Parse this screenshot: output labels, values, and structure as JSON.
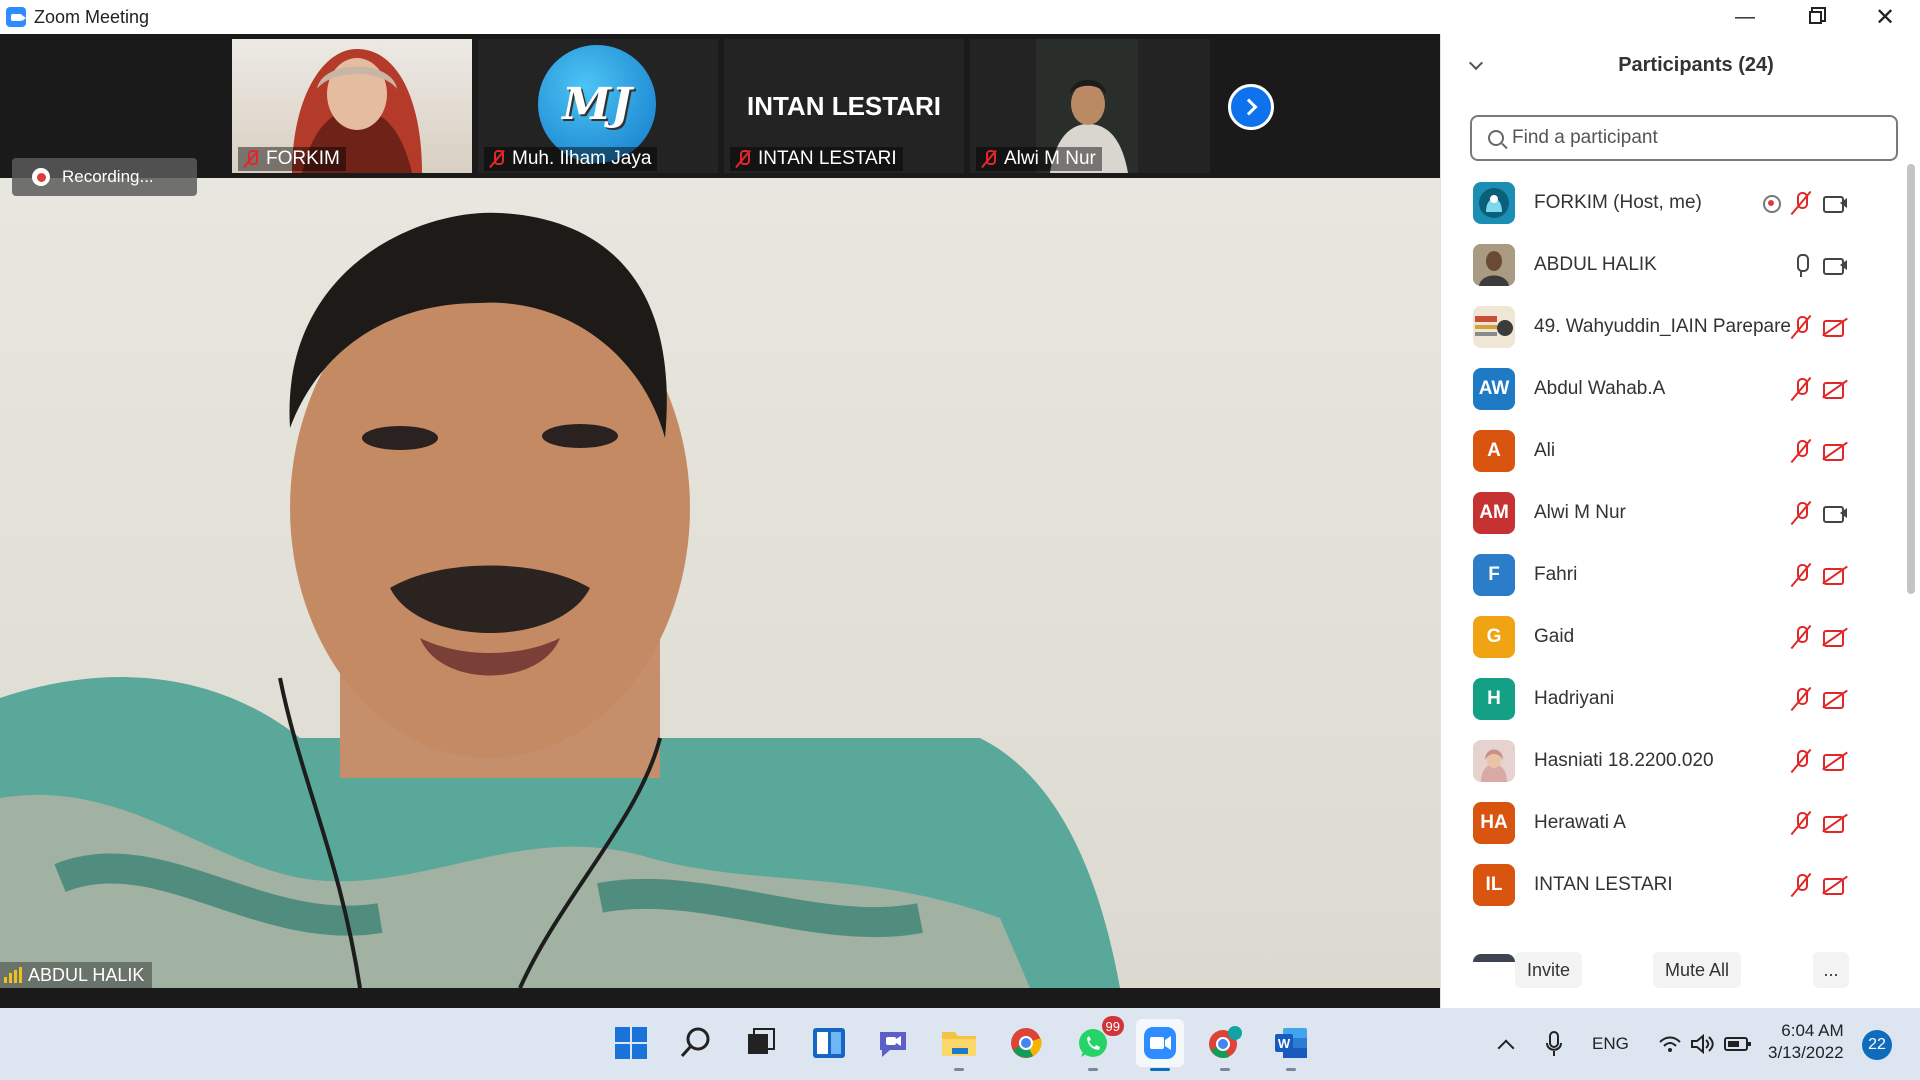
{
  "window": {
    "title": "Zoom Meeting"
  },
  "recording": {
    "label": "Recording..."
  },
  "thumbnails": [
    {
      "name": "FORKIM"
    },
    {
      "name": "Muh. Ilham Jaya",
      "logo_text": "MJ"
    },
    {
      "name": "INTAN LESTARI",
      "display_text": "INTAN LESTARI"
    },
    {
      "name": "Alwi M Nur"
    }
  ],
  "main_video": {
    "speaker": "ABDUL HALIK"
  },
  "participants_panel": {
    "title": "Participants (24)",
    "search_placeholder": "Find a participant",
    "participants": [
      {
        "name": "FORKIM (Host, me)",
        "avatar": "",
        "avatar_color": "#1a8fb3",
        "mic": "off",
        "video": "on",
        "recording": true
      },
      {
        "name": "ABDUL HALIK",
        "avatar": "",
        "avatar_color": "#8a7a5a",
        "mic": "on",
        "video": "on"
      },
      {
        "name": "49. Wahyuddin_IAIN Parepare",
        "avatar": "",
        "avatar_color": "#c9b9a0",
        "mic": "off",
        "video": "off"
      },
      {
        "name": "Abdul Wahab.A",
        "avatar": "AW",
        "avatar_color": "#1e7ac4",
        "mic": "off",
        "video": "off"
      },
      {
        "name": "Ali",
        "avatar": "A",
        "avatar_color": "#d9540f",
        "mic": "off",
        "video": "off"
      },
      {
        "name": "Alwi M Nur",
        "avatar": "AM",
        "avatar_color": "#c63131",
        "mic": "off",
        "video": "on"
      },
      {
        "name": "Fahri",
        "avatar": "F",
        "avatar_color": "#2b7cc9",
        "mic": "off",
        "video": "off"
      },
      {
        "name": "Gaid",
        "avatar": "G",
        "avatar_color": "#f0a414",
        "mic": "off",
        "video": "off"
      },
      {
        "name": "Hadriyani",
        "avatar": "H",
        "avatar_color": "#14a085",
        "mic": "off",
        "video": "off"
      },
      {
        "name": "Hasniati 18.2200.020",
        "avatar": "",
        "avatar_color": "#e6d2cf",
        "mic": "off",
        "video": "off"
      },
      {
        "name": "Herawati A",
        "avatar": "HA",
        "avatar_color": "#d9540f",
        "mic": "off",
        "video": "off"
      },
      {
        "name": "INTAN LESTARI",
        "avatar": "IL",
        "avatar_color": "#d9540f",
        "mic": "off",
        "video": "off"
      }
    ],
    "footer": {
      "invite": "Invite",
      "mute_all": "Mute All",
      "more": "..."
    }
  },
  "taskbar": {
    "apps": [
      "windows-start",
      "search",
      "task-view",
      "widgets",
      "teams-chat",
      "file-explorer",
      "chrome",
      "whatsapp",
      "zoom",
      "chrome-profile",
      "word"
    ],
    "whatsapp_badge": "99",
    "language": "ENG",
    "time": "6:04 AM",
    "date": "3/13/2022",
    "notifications": "22"
  }
}
